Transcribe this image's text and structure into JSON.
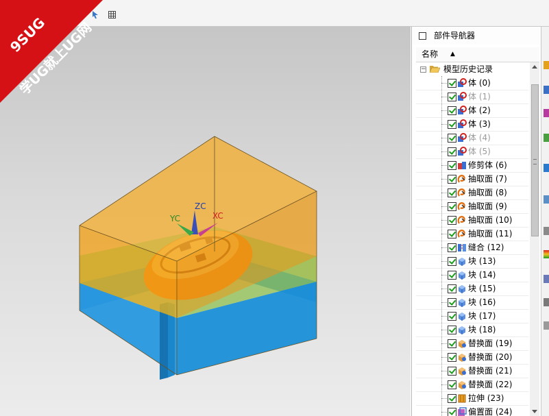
{
  "banner": {
    "brand": "9SUG",
    "slogan": "学UG就上UG网",
    "color": "#e8131a"
  },
  "viewport": {
    "axes": {
      "x": "XC",
      "y": "YC",
      "z": "ZC"
    },
    "colors": {
      "upper_block": "#f0a21a",
      "lower_block": "#1a8fd8",
      "part": "#f08a10",
      "background": "#d6d6d6"
    }
  },
  "navigator": {
    "title": "部件导航器",
    "column_name": "名称",
    "sort_indicator": "▲",
    "root": {
      "expander": "−",
      "label": "模型历史记录"
    },
    "items": [
      {
        "label": "体 (0)",
        "icon": "body-icon",
        "dim": false
      },
      {
        "label": "体 (1)",
        "icon": "body-icon",
        "dim": true
      },
      {
        "label": "体 (2)",
        "icon": "body-icon",
        "dim": false
      },
      {
        "label": "体 (3)",
        "icon": "body-icon",
        "dim": false
      },
      {
        "label": "体 (4)",
        "icon": "body-icon",
        "dim": true
      },
      {
        "label": "体 (5)",
        "icon": "body-icon",
        "dim": true
      },
      {
        "label": "修剪体 (6)",
        "icon": "trim-body-icon",
        "dim": false
      },
      {
        "label": "抽取面 (7)",
        "icon": "extract-face-icon",
        "dim": false
      },
      {
        "label": "抽取面 (8)",
        "icon": "extract-face-icon",
        "dim": false
      },
      {
        "label": "抽取面 (9)",
        "icon": "extract-face-icon",
        "dim": false
      },
      {
        "label": "抽取面 (10)",
        "icon": "extract-face-icon",
        "dim": false
      },
      {
        "label": "抽取面 (11)",
        "icon": "extract-face-icon",
        "dim": false
      },
      {
        "label": "缝合 (12)",
        "icon": "sew-icon",
        "dim": false
      },
      {
        "label": "块 (13)",
        "icon": "block-icon",
        "dim": false
      },
      {
        "label": "块 (14)",
        "icon": "block-icon",
        "dim": false
      },
      {
        "label": "块 (15)",
        "icon": "block-icon",
        "dim": false
      },
      {
        "label": "块 (16)",
        "icon": "block-icon",
        "dim": false
      },
      {
        "label": "块 (17)",
        "icon": "block-icon",
        "dim": false
      },
      {
        "label": "块 (18)",
        "icon": "block-icon",
        "dim": false
      },
      {
        "label": "替换面 (19)",
        "icon": "replace-face-icon",
        "dim": false
      },
      {
        "label": "替换面 (20)",
        "icon": "replace-face-icon",
        "dim": false
      },
      {
        "label": "替换面 (21)",
        "icon": "replace-face-icon",
        "dim": false
      },
      {
        "label": "替换面 (22)",
        "icon": "replace-face-icon",
        "dim": false
      },
      {
        "label": "拉伸 (23)",
        "icon": "extrude-icon",
        "dim": false
      },
      {
        "label": "偏置面 (24)",
        "icon": "offset-face-icon",
        "dim": false
      }
    ]
  }
}
